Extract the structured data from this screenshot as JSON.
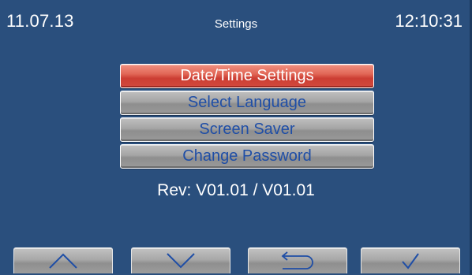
{
  "header": {
    "date": "11.07.13",
    "title": "Settings",
    "time": "12:10:31"
  },
  "menu": {
    "items": [
      {
        "label": "Date/Time Settings",
        "active": true
      },
      {
        "label": "Select Language",
        "active": false
      },
      {
        "label": "Screen Saver",
        "active": false
      },
      {
        "label": "Change Password",
        "active": false
      }
    ]
  },
  "revision": "Rev: V01.01 / V01.01",
  "navigation": {
    "buttons": [
      {
        "icon": "arrow-up-icon"
      },
      {
        "icon": "arrow-down-icon"
      },
      {
        "icon": "back-return-icon"
      },
      {
        "icon": "checkmark-icon"
      }
    ]
  },
  "colors": {
    "background": "#2a4f7d",
    "active_button": "#e05a4a",
    "inactive_button": "#a5a5a5",
    "button_text": "#1f4ea6"
  }
}
